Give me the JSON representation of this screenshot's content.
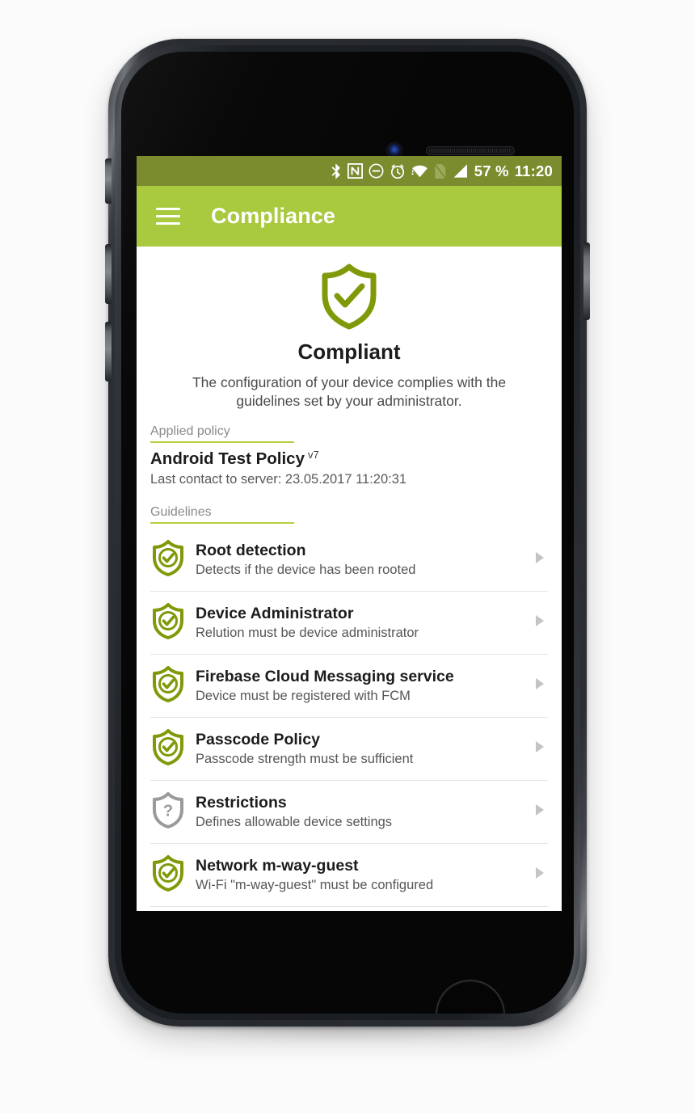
{
  "device": {
    "hardware": {
      "earpiece": "earpiece-speaker",
      "camera": "front-camera",
      "home_button": "home-button",
      "mute_switch": "mute-switch",
      "volume_up": "volume-up-button",
      "volume_down": "volume-down-button",
      "power": "power-button"
    }
  },
  "statusbar": {
    "icons": [
      "bluetooth-icon",
      "nfc-icon",
      "do-not-disturb-icon",
      "alarm-icon",
      "wifi-icon",
      "sim-off-icon",
      "signal-icon"
    ],
    "battery": "57 %",
    "clock": "11:20",
    "background": "#7b8c2f"
  },
  "appbar": {
    "menu_icon": "hamburger-menu-icon",
    "title": "Compliance",
    "background": "#a9c93f"
  },
  "hero": {
    "icon": "shield-check-icon",
    "status": "Compliant",
    "description": "The configuration of your device complies with the guidelines set by your administrator.",
    "accent": "#7f9a08"
  },
  "applied_policy": {
    "section_label": "Applied policy",
    "policy_name": "Android Test Policy",
    "version": "v7",
    "last_contact": "Last contact to server: 23.05.2017 11:20:31"
  },
  "guidelines": {
    "section_label": "Guidelines",
    "items": [
      {
        "icon": "shield-check-icon",
        "status": "compliant",
        "title": "Root detection",
        "subtitle": "Detects if the device has been rooted",
        "arrow": "chevron-right-icon"
      },
      {
        "icon": "shield-check-icon",
        "status": "compliant",
        "title": "Device Administrator",
        "subtitle": "Relution must be device administrator",
        "arrow": "chevron-right-icon"
      },
      {
        "icon": "shield-check-icon",
        "status": "compliant",
        "title": "Firebase Cloud Messaging service",
        "subtitle": "Device must be registered with FCM",
        "arrow": "chevron-right-icon"
      },
      {
        "icon": "shield-check-icon",
        "status": "compliant",
        "title": "Passcode Policy",
        "subtitle": "Passcode strength must be sufficient",
        "arrow": "chevron-right-icon"
      },
      {
        "icon": "shield-question-icon",
        "status": "unknown",
        "title": "Restrictions",
        "subtitle": "Defines allowable device settings",
        "arrow": "chevron-right-icon"
      },
      {
        "icon": "shield-check-icon",
        "status": "compliant",
        "title": "Network m-way-guest",
        "subtitle": "Wi-Fi \"m-way-guest\" must be configured",
        "arrow": "chevron-right-icon"
      }
    ]
  },
  "colors": {
    "status_bar_green": "#7b8c2f",
    "app_bar_green": "#a9c93f",
    "shield_green": "#7f9a08",
    "underline_green": "#b5ce3f",
    "shield_gray": "#9a9a9a",
    "arrow_gray": "#c4c4c4"
  }
}
